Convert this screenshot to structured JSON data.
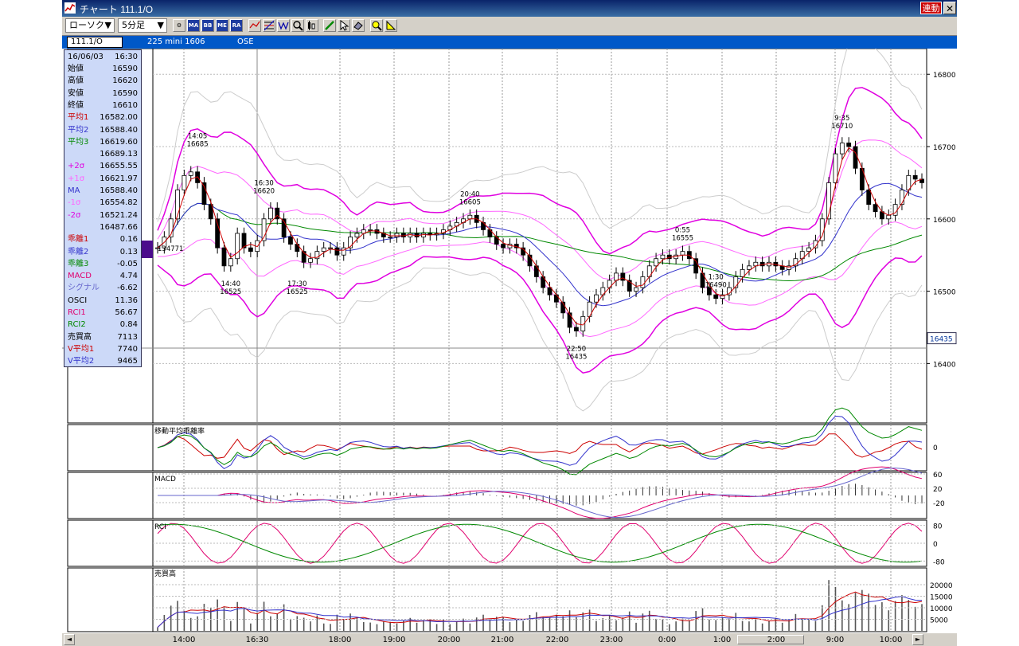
{
  "window": {
    "title": "チャート 111.1/O",
    "link_badge": "連動",
    "close_label": "✕"
  },
  "toolbar": {
    "chart_type": "ローソク",
    "interval": "5分足",
    "dropdown_arrow": "▼",
    "icons": [
      "settings-icon",
      "ma-icon",
      "bb-icon",
      "me-icon",
      "ra-icon",
      "line-icon",
      "fib-icon",
      "wave-icon",
      "zoom-icon",
      "bars-icon",
      "pen-icon",
      "cursor-icon",
      "eraser-icon",
      "magnify-icon",
      "ruler-icon"
    ],
    "icon_labels": {
      "ma": "MA",
      "bb": "BB",
      "me": "ME",
      "ra": "RA"
    }
  },
  "symbol": {
    "code": "111.1/O",
    "description": "225 mini 1606",
    "exchange": "OSE"
  },
  "info_panel": {
    "date": "16/06/03",
    "time": "16:30",
    "rows": [
      {
        "label": "始値",
        "value": "16590",
        "color": "#000000"
      },
      {
        "label": "高値",
        "value": "16620",
        "color": "#000000"
      },
      {
        "label": "安値",
        "value": "16590",
        "color": "#000000"
      },
      {
        "label": "終値",
        "value": "16610",
        "color": "#000000"
      },
      {
        "label": "平均1",
        "value": "16582.00",
        "color": "#cc0000"
      },
      {
        "label": "平均2",
        "value": "16588.40",
        "color": "#3333cc"
      },
      {
        "label": "平均3",
        "value": "16619.60",
        "color": "#008800"
      },
      {
        "label": "",
        "value": "16689.13",
        "color": "#000000"
      },
      {
        "label": "+2σ",
        "value": "16655.55",
        "color": "#e000e0"
      },
      {
        "label": "+1σ",
        "value": "16621.97",
        "color": "#ff66ff"
      },
      {
        "label": "MA",
        "value": "16588.40",
        "color": "#3333cc"
      },
      {
        "label": "-1σ",
        "value": "16554.82",
        "color": "#ff66ff"
      },
      {
        "label": "-2σ",
        "value": "16521.24",
        "color": "#e000e0"
      },
      {
        "label": "",
        "value": "16487.66",
        "color": "#000000"
      },
      {
        "label": "乖離1",
        "value": "0.16",
        "color": "#cc0000"
      },
      {
        "label": "乖離2",
        "value": "0.13",
        "color": "#3333cc"
      },
      {
        "label": "乖離3",
        "value": "-0.05",
        "color": "#008800"
      },
      {
        "label": "MACD",
        "value": "4.74",
        "color": "#e0006e"
      },
      {
        "label": "シグナル",
        "value": "-6.62",
        "color": "#6666cc"
      },
      {
        "label": "OSCI",
        "value": "11.36",
        "color": "#000000"
      },
      {
        "label": "RCI1",
        "value": "56.67",
        "color": "#e0006e"
      },
      {
        "label": "RCI2",
        "value": "0.84",
        "color": "#008800"
      },
      {
        "label": "売買高",
        "value": "7113",
        "color": "#000000"
      },
      {
        "label": "V平均1",
        "value": "7740",
        "color": "#cc0000"
      },
      {
        "label": "V平均2",
        "value": "9465",
        "color": "#3333cc"
      }
    ]
  },
  "panels": {
    "deviation": {
      "title": "移動平均乖離率",
      "ticks": [
        "0"
      ]
    },
    "macd": {
      "title": "MACD",
      "ticks": [
        "60",
        "20",
        "-20"
      ]
    },
    "rci": {
      "title": "RCI",
      "ticks": [
        "80",
        "0",
        "-80"
      ]
    },
    "volume": {
      "title": "売買高",
      "ticks": [
        "20000",
        "15000",
        "10000",
        "5000"
      ]
    }
  },
  "chart_data": {
    "type": "candlestick",
    "price_axis": {
      "ticks": [
        16800,
        16700,
        16600,
        16500,
        16400
      ],
      "range": [
        16320,
        16830
      ]
    },
    "current_price_label": "16435",
    "x_labels": [
      "14:00",
      "16:30",
      "18:00",
      "19:00",
      "20:00",
      "21:00",
      "22:00",
      "23:00",
      "0:00",
      "1:00",
      "2:00",
      "9:00",
      "10:00"
    ],
    "annotations": [
      {
        "time": "14:05",
        "price": "16685"
      },
      {
        "time": "16:30",
        "price": "16620"
      },
      {
        "time": "14:40",
        "price": "16525"
      },
      {
        "time": "17:30",
        "price": "16525"
      },
      {
        "time": "20:40",
        "price": "16605"
      },
      {
        "time": "22:50",
        "price": "16435"
      },
      {
        "time": "0:55",
        "price": "16555"
      },
      {
        "time": "1:30",
        "price": "16490"
      },
      {
        "time": "9:35",
        "price": "16710"
      }
    ],
    "left_marker": "134771",
    "close_series": [
      16560,
      16575,
      16600,
      16640,
      16660,
      16665,
      16650,
      16620,
      16600,
      16560,
      16535,
      16545,
      16580,
      16560,
      16555,
      16570,
      16600,
      16615,
      16600,
      16575,
      16565,
      16555,
      16540,
      16545,
      16555,
      16560,
      16560,
      16550,
      16560,
      16575,
      16580,
      16585,
      16585,
      16580,
      16575,
      16575,
      16580,
      16575,
      16580,
      16575,
      16580,
      16578,
      16580,
      16585,
      16590,
      16595,
      16600,
      16605,
      16595,
      16585,
      16575,
      16565,
      16560,
      16565,
      16560,
      16550,
      16535,
      16520,
      16505,
      16495,
      16485,
      16470,
      16450,
      16445,
      16465,
      16485,
      16495,
      16505,
      16515,
      16525,
      16515,
      16500,
      16505,
      16520,
      16535,
      16545,
      16550,
      16545,
      16550,
      16555,
      16545,
      16525,
      16505,
      16495,
      16490,
      16495,
      16505,
      16520,
      16530,
      16535,
      16540,
      16535,
      16540,
      16535,
      16530,
      16535,
      16545,
      16555,
      16560,
      16570,
      16600,
      16650,
      16690,
      16705,
      16700,
      16670,
      16640,
      16620,
      16610,
      16600,
      16605,
      16620,
      16640,
      16660,
      16655,
      16650
    ]
  },
  "scrollbar": {
    "left_arrow": "◄",
    "right_arrow": "►"
  }
}
